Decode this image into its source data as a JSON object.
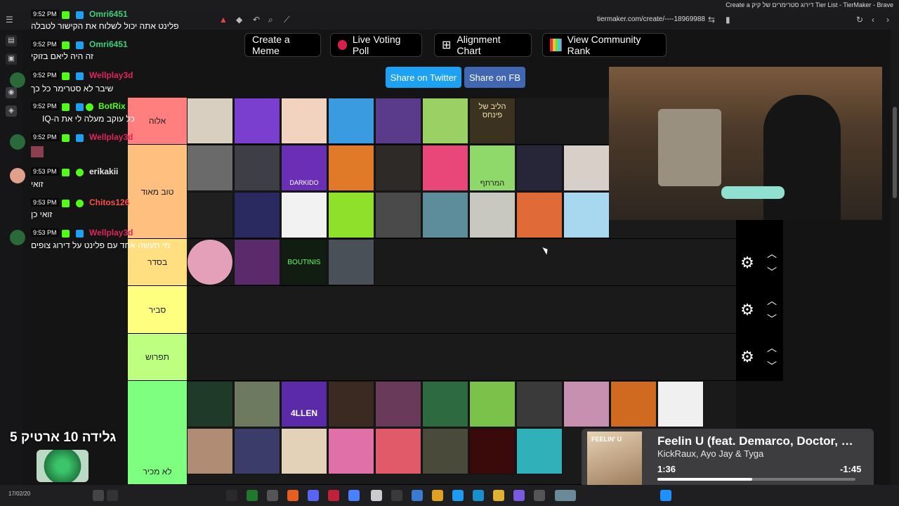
{
  "window": {
    "title": "Create a דירוג סטרימרים של קיק Tier List - TierMaker - Brave"
  },
  "address_bar": {
    "url": "tiermaker.com/create/----18969988"
  },
  "buttons": {
    "create_meme": "Create a Meme",
    "live_voting": "Live Voting Poll",
    "alignment": "Alignment Chart",
    "community_rank": "View Community Rank",
    "share_twitter": "Share on Twitter",
    "share_fb": "Share on FB"
  },
  "colors": {
    "twitter": "#1da1f2",
    "facebook": "#4267b2",
    "tier_s": "#ff7f7f",
    "tier_a": "#ffbf7f",
    "tier_b": "#ffdf7f",
    "tier_c": "#ffff7f",
    "tier_d": "#bfff7f",
    "tier_e": "#7fff7f"
  },
  "tiers": [
    {
      "label": "אלוה"
    },
    {
      "label": "טוב מאוד"
    },
    {
      "label": "בסדר"
    },
    {
      "label": "סביר"
    },
    {
      "label": "תפרוש"
    },
    {
      "label": "לא מכיר"
    }
  ],
  "tier_item_texts": {
    "pinhas": "הליב של פינחס",
    "darkido": "DARKIDO",
    "ameratef": "המרתף",
    "boutinis": "BOUTINIS",
    "allen": "4LLEN"
  },
  "chat": [
    {
      "time": "9:52 PM",
      "user": "Omri6451",
      "color": "#3fd07c",
      "text": "פלינט אתה יכול לשלוח את הקישור לטבלה"
    },
    {
      "time": "9:52 PM",
      "user": "Omri6451",
      "color": "#3fd07c",
      "text": "זה היה ליאם בזוקי"
    },
    {
      "time": "9:52 PM",
      "user": "Wellplay3d",
      "color": "#e0245e",
      "text": "שיבר לא סטרימר כל כך"
    },
    {
      "time": "9:52 PM",
      "user": "BotRix",
      "color": "#53fc18",
      "text": "כל עוקב מעלה לי את ה-IQ"
    },
    {
      "time": "9:52 PM",
      "user": "Wellplay3d",
      "color": "#e0245e",
      "text": ""
    },
    {
      "time": "9:53 PM",
      "user": "erikakii",
      "color": "#e6e6e6",
      "text": "זואי"
    },
    {
      "time": "9:53 PM",
      "user": "Chitos126",
      "color": "#ff4d4d",
      "text": "זואי כן"
    },
    {
      "time": "9:53 PM",
      "user": "Wellplay3d",
      "color": "#e0245e",
      "text": "מי תעשה אחד עם פלינט על דירוג צופים"
    }
  ],
  "overlay": {
    "goal_text": "גלידה 10 ארטיק 5"
  },
  "media": {
    "song": "Feelin U (feat. Demarco, Doctor, …",
    "artist": "KickRaux, Ayo Jay & Tyga",
    "elapsed": "1:36",
    "remaining": "-1:45",
    "progress": 0.48,
    "art_text": "FEELIN' U"
  },
  "taskbar": {
    "date": "17/02/20"
  },
  "icons": [
    "kick-badge-icon",
    "gear-icon",
    "chevron-up-icon",
    "chevron-down-icon",
    "reload-icon",
    "grid-icon",
    "poll-dot-icon"
  ]
}
